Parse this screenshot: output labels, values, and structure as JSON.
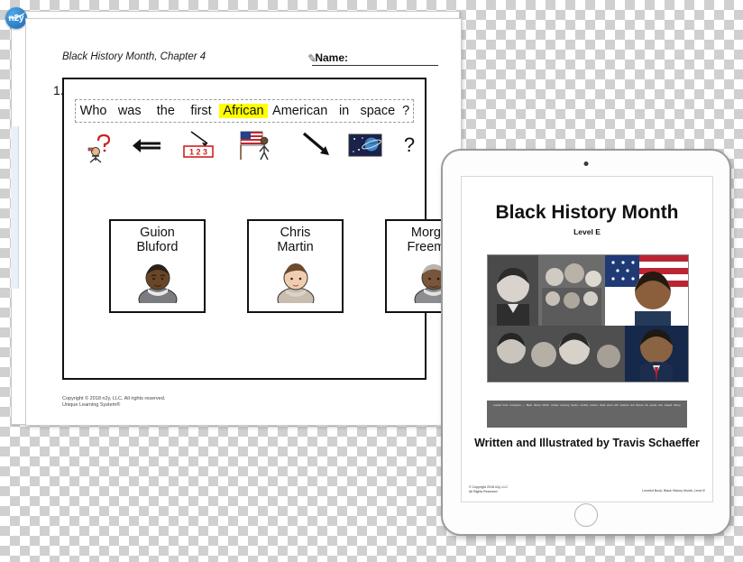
{
  "logo": {
    "text": "n2y"
  },
  "worksheet": {
    "chapter": "Black History Month, Chapter 4",
    "name_label": "Name:",
    "question_number": "1.",
    "question_words": [
      {
        "text": "Who",
        "highlight": false
      },
      {
        "text": "was",
        "highlight": false
      },
      {
        "text": "the",
        "highlight": false
      },
      {
        "text": "first",
        "highlight": false
      },
      {
        "text": "African",
        "highlight": true
      },
      {
        "text": "American",
        "highlight": false
      },
      {
        "text": "in",
        "highlight": false
      },
      {
        "text": "space",
        "highlight": false
      },
      {
        "text": "?",
        "highlight": false
      }
    ],
    "symbols": [
      {
        "name": "who-person-question-symbol",
        "label": "who"
      },
      {
        "name": "was-past-arrow-symbol",
        "label": "was"
      },
      {
        "name": "first-123-symbol",
        "label": "first",
        "digits": "1 2 3"
      },
      {
        "name": "african-american-flag-person-symbol",
        "label": "African American"
      },
      {
        "name": "in-arrow-symbol",
        "label": "in"
      },
      {
        "name": "space-planet-symbol",
        "label": "space"
      },
      {
        "name": "question-mark-symbol",
        "label": "?"
      }
    ],
    "choices": [
      {
        "name": "Guion Bluford",
        "lines": [
          "Guion",
          "Bluford"
        ]
      },
      {
        "name": "Chris Martin",
        "lines": [
          "Chris",
          "Martin"
        ]
      },
      {
        "name": "Morgan Freeman",
        "lines": [
          "Morgan",
          "Freeman"
        ]
      }
    ],
    "footer_lines": [
      "Copyright © 2018 n2y, LLC. All rights reserved.",
      "Unique Learning System®"
    ]
  },
  "ipad": {
    "book": {
      "title": "Black History Month",
      "level": "Level E",
      "band_text": "Leveled book companion — Black History Month. Unique Learning System monthly content. Read aloud with students and discuss the people who shaped history.",
      "author": "Written and Illustrated by Travis Schaeffer",
      "copyright_lines": [
        "© Copyright 2018 n2y, LLC",
        "All Rights Reserved"
      ],
      "meta": "Leveled Book, Black History Month, Level E"
    }
  }
}
